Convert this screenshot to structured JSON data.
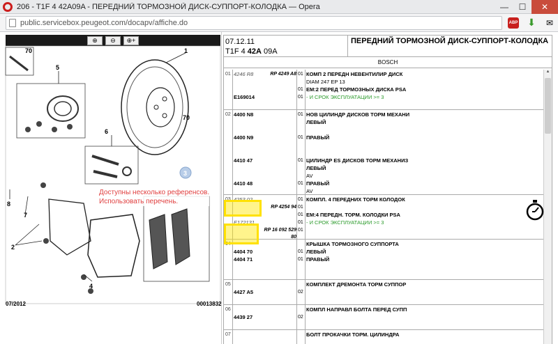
{
  "browser": {
    "title": "206 - T1F 4 42A09A - ПЕРЕДНИЙ ТОРМОЗНОЙ ДИСК-СУППОРТ-КОЛОДКА — Opera",
    "url": "public.servicebox.peugeot.com/docapv/affiche.do",
    "minimize": "—",
    "maximize": "☐",
    "close": "✕"
  },
  "diagram": {
    "zoom_in_icon": "zoom-in-icon",
    "zoom_out_icon": "zoom-out-icon",
    "zoom_fit_icon": "zoom-fit-icon",
    "callout_line1": "Доступны несколько референсов.",
    "callout_line2": "Использовать перечень.",
    "footer_date": "07/2012",
    "footer_code": "00013832",
    "labels": [
      "70",
      "5",
      "1",
      "70",
      "6",
      "3",
      "8",
      "7",
      "2",
      "4"
    ]
  },
  "header": {
    "date": "07.12.11",
    "code_prefix": "T1F 4 ",
    "code_bold": "42A",
    "code_suffix": " 09A",
    "title": "ПЕРЕДНИЙ ТОРМОЗНОЙ ДИСК-СУППОРТ-КОЛОДКА",
    "brand": "BOSCH"
  },
  "rows": [
    {
      "idx": "01",
      "lines": [
        {
          "ref": "4246 R8",
          "ref_style": "it",
          "rp": "RP 4249 A8",
          "qty": "01",
          "desc": "КОМП 2 ПЕРЕДН НЕВЕНТИЛИР ДИСК",
          "desc_style": "b"
        },
        {
          "ref": "",
          "rp": "",
          "qty": "",
          "desc": "DIAM 247 EP 13",
          "desc_style": ""
        },
        {
          "ref": "",
          "rp": "",
          "qty": "01",
          "desc": "ЕМ:2 ПЕРЕД ТОРМОЗНЫХ ДИСКА PSA",
          "desc_style": "b"
        },
        {
          "ref": "E169014",
          "ref_style": "b",
          "rp": "",
          "qty": "01",
          "desc": "- И СРОК ЭКСПЛУАТАЦИИ >= 3",
          "desc_style": "green"
        }
      ]
    },
    {
      "idx": "02",
      "lines": [
        {
          "ref": "4400 N8",
          "ref_style": "b",
          "rp": "",
          "qty": "01",
          "desc": "НОВ ЦИЛИНДР ДИСКОВ ТОРМ МЕХАНИ",
          "desc_style": "b"
        },
        {
          "ref": "",
          "rp": "",
          "qty": "",
          "desc": "ЛЕВЫЙ",
          "desc_style": "b"
        },
        {
          "ref": "4400 N9",
          "ref_style": "b",
          "rp": "",
          "qty": "01",
          "desc": "ПРАВЫЙ",
          "desc_style": "b"
        },
        {
          "ref": "4410 47",
          "ref_style": "b",
          "rp": "",
          "qty": "01",
          "desc": "ЦИЛИНДР ES ДИСКОВ ТОРМ МЕХАНИЗ",
          "desc_style": "b"
        },
        {
          "ref": "",
          "rp": "",
          "qty": "",
          "desc": "ЛЕВЫЙ",
          "desc_style": "b"
        },
        {
          "ref": "",
          "rp": "",
          "qty": "",
          "desc": "AV",
          "desc_style": ""
        },
        {
          "ref": "4410 48",
          "ref_style": "b",
          "rp": "",
          "qty": "01",
          "desc": "ПРАВЫЙ",
          "desc_style": "b"
        },
        {
          "ref": "",
          "rp": "",
          "qty": "",
          "desc": "AV",
          "desc_style": ""
        }
      ]
    },
    {
      "idx": "03",
      "lines": [
        {
          "ref": "4253 02",
          "ref_style": "it",
          "rp": "",
          "qty": "01",
          "desc": "КОМПЛ. 4 ПЕРЕДНИХ ТОРМ КОЛОДОК",
          "desc_style": "b"
        },
        {
          "ref": "",
          "rp": "RP 4254 94",
          "qty": "01",
          "desc": "",
          "desc_style": ""
        },
        {
          "ref": "",
          "rp": "",
          "qty": "01",
          "desc": "ЕМ:4 ПЕРЕДН. ТОРМ. КОЛОДКИ PSA",
          "desc_style": "b"
        },
        {
          "ref": "E172131",
          "ref_style": "it",
          "rp": "",
          "qty": "01",
          "desc": "- И СРОК ЭКСПЛУАТАЦИИ >= 3",
          "desc_style": "green"
        },
        {
          "ref": "",
          "rp": "RP 16 092 529 80",
          "qty": "01",
          "desc": "",
          "desc_style": ""
        }
      ]
    },
    {
      "idx": "04",
      "lines": [
        {
          "ref": "",
          "rp": "",
          "qty": "",
          "desc": "КРЫШКА ТОРМОЗНОГО СУППОРТА",
          "desc_style": "b"
        },
        {
          "ref": "4404 70",
          "ref_style": "b",
          "rp": "",
          "qty": "01",
          "desc": "ЛЕВЫЙ",
          "desc_style": "b"
        },
        {
          "ref": "4404 71",
          "ref_style": "b",
          "rp": "",
          "qty": "01",
          "desc": "ПРАВЫЙ",
          "desc_style": "b"
        }
      ]
    },
    {
      "idx": "05",
      "lines": [
        {
          "ref": "",
          "rp": "",
          "qty": "",
          "desc": "КОМПЛЕКТ ДРЕМОНТА ТОРМ СУППОР",
          "desc_style": "b"
        },
        {
          "ref": "4427 A5",
          "ref_style": "b",
          "rp": "",
          "qty": "02",
          "desc": "",
          "desc_style": ""
        }
      ]
    },
    {
      "idx": "06",
      "lines": [
        {
          "ref": "",
          "rp": "",
          "qty": "",
          "desc": "КОМПЛ НАПРАВЛ БОЛТА ПЕРЕД СУПП",
          "desc_style": "b"
        },
        {
          "ref": "4439 27",
          "ref_style": "b",
          "rp": "",
          "qty": "02",
          "desc": "",
          "desc_style": ""
        }
      ]
    },
    {
      "idx": "07",
      "lines": [
        {
          "ref": "",
          "rp": "",
          "qty": "",
          "desc": "БОЛТ ПРОКАЧКИ ТОРМ. ЦИЛИНДРА",
          "desc_style": "b"
        }
      ]
    }
  ]
}
